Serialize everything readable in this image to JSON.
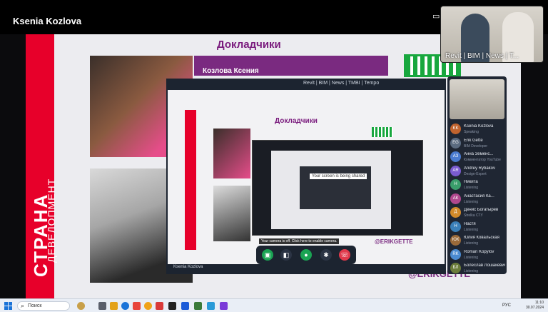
{
  "presenter": {
    "name": "Ksenia Kozlova"
  },
  "slide": {
    "title": "Докладчики",
    "brand_main": "СТРАНА",
    "brand_sub": "ДЕВЕЛОПМЕНТ",
    "speaker1_band": "Козлова Ксения",
    "handle": "@ERIKGETTE"
  },
  "camera": {
    "tags": "Revit | BIM | News | T..."
  },
  "shared_window": {
    "title": "Докладчики",
    "tabs": "Revit | BIM | News | TMBI | Tempo",
    "share_label": "Your screen is being shared",
    "user": "Ksenia Kozlova",
    "notice": "Your camera is off. Click here to enable camera."
  },
  "participants": [
    {
      "initials": "KK",
      "name": "Ksenia Kozlova",
      "sub": "Speaking",
      "color": "#c0632e"
    },
    {
      "initials": "EG",
      "name": "Erik Gette",
      "sub": "BIM Developer",
      "color": "#5b6b80"
    },
    {
      "initials": "АЗ",
      "name": "Анна Земенс...",
      "sub": "Комментатор YouTube",
      "color": "#4a7bd0"
    },
    {
      "initials": "AR",
      "name": "Andrey Rybakov",
      "sub": "Design-Expert",
      "color": "#7a5bd0"
    },
    {
      "initials": "Н",
      "name": "Никита",
      "sub": "Listening",
      "color": "#3a9d6b"
    },
    {
      "initials": "АК",
      "name": "Анастасия Ка...",
      "sub": "Listening",
      "color": "#b0478d"
    },
    {
      "initials": "Д",
      "name": "Денис Богатырев",
      "sub": "Strelka СТУ",
      "color": "#d18a2a"
    },
    {
      "initials": "Н",
      "name": "Настя",
      "sub": "Listening",
      "color": "#3a7fb8"
    },
    {
      "initials": "ЮК",
      "name": "Юлия Ковальская",
      "sub": "Listening",
      "color": "#9a6a3a"
    },
    {
      "initials": "RK",
      "name": "Roman Kopylov",
      "sub": "Listening",
      "color": "#4a8ad0"
    },
    {
      "initials": "БЛ",
      "name": "Болеслав Лошакевич...",
      "sub": "Listening",
      "color": "#6b7c3a"
    }
  ],
  "controls": [
    "share-screen",
    "camera-off",
    "microphone",
    "settings",
    "hang-up"
  ],
  "taskbar": {
    "search": "Поиск",
    "time": "11:10",
    "date": "30.07.2024",
    "lang": "РУС"
  }
}
